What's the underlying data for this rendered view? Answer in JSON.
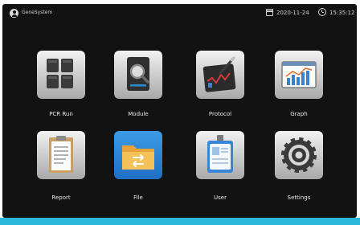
{
  "status_bar": {
    "system_name": "GeneSystem",
    "date": "2020-11-24",
    "time": "15:35:12",
    "icons": {
      "user": "user-icon",
      "calendar": "calendar-icon",
      "clock": "clock-icon"
    }
  },
  "apps": [
    {
      "label": "PCR Run",
      "icon": "pcr-run-icon"
    },
    {
      "label": "Module",
      "icon": "module-icon"
    },
    {
      "label": "Protocol",
      "icon": "protocol-icon"
    },
    {
      "label": "Graph",
      "icon": "graph-icon"
    },
    {
      "label": "Report",
      "icon": "report-icon"
    },
    {
      "label": "File",
      "icon": "file-icon"
    },
    {
      "label": "User",
      "icon": "user-card-icon"
    },
    {
      "label": "Settings",
      "icon": "settings-icon"
    }
  ],
  "colors": {
    "screen_bg": "#121212",
    "accent": "#2bb8d9",
    "file_tile": "#2a86d9"
  }
}
